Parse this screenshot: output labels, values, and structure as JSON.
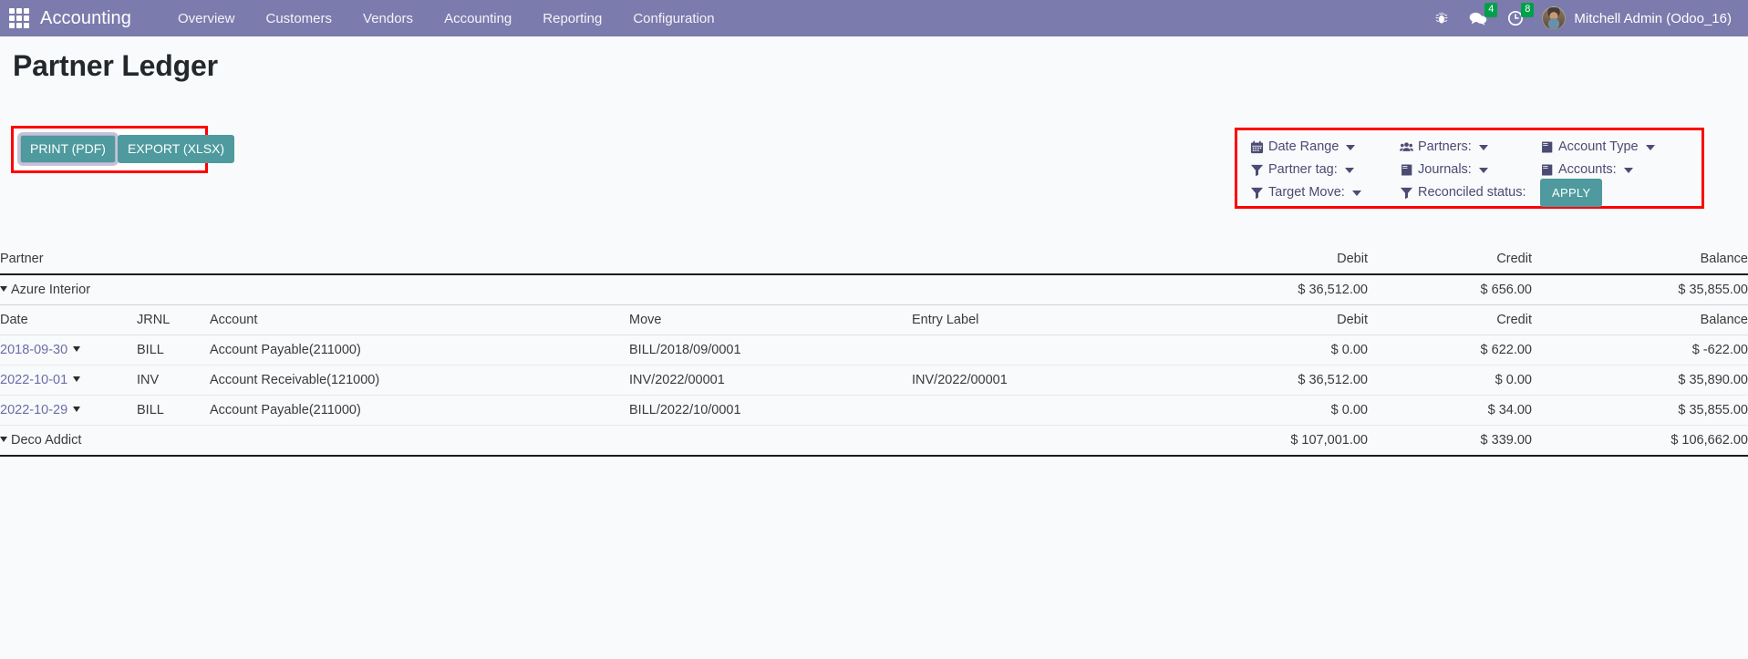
{
  "navbar": {
    "apps_icon": "apps-grid-icon",
    "brand": "Accounting",
    "menu": [
      {
        "label": "Overview"
      },
      {
        "label": "Customers"
      },
      {
        "label": "Vendors"
      },
      {
        "label": "Accounting"
      },
      {
        "label": "Reporting"
      },
      {
        "label": "Configuration"
      }
    ],
    "bug_icon": "bug-icon",
    "messages": {
      "icon": "chat-bubbles-icon",
      "count": "4"
    },
    "activities": {
      "icon": "clock-icon",
      "count": "8"
    },
    "user": {
      "avatar": "user-avatar",
      "name": "Mitchell Admin (Odoo_16)"
    },
    "brand_color": "#7c7bad",
    "badge_color": "#00a04a"
  },
  "page": {
    "title": "Partner Ledger"
  },
  "actions": {
    "print_pdf": "PRINT (PDF)",
    "export_xlsx": "EXPORT (XLSX)",
    "button_color": "#4e9a9e",
    "annotation_color": "#ff0000"
  },
  "filters": {
    "annotation_color": "#ff0000",
    "items": [
      {
        "label": "Date Range",
        "icon": "calendar-icon",
        "caret": true
      },
      {
        "label": "Partners:",
        "icon": "people-icon",
        "caret": true
      },
      {
        "label": "Account Type",
        "icon": "book-icon",
        "caret": true
      },
      {
        "label": "Partner tag:",
        "icon": "funnel-icon",
        "caret": true
      },
      {
        "label": "Journals:",
        "icon": "book-icon",
        "caret": true
      },
      {
        "label": "Accounts:",
        "icon": "book-icon",
        "caret": true
      },
      {
        "label": "Target Move:",
        "icon": "funnel-icon",
        "caret": true
      },
      {
        "label": "Reconciled status:",
        "icon": "funnel-icon",
        "caret": false
      }
    ],
    "apply_label": "APPLY"
  },
  "report": {
    "main_headers": [
      "Partner",
      "Debit",
      "Credit",
      "Balance"
    ],
    "sub_headers": [
      "Date",
      "JRNL",
      "Account",
      "Move",
      "Entry Label",
      "Debit",
      "Credit",
      "Balance"
    ],
    "partners": [
      {
        "name": "Azure Interior",
        "debit": "$ 36,512.00",
        "credit": "$ 656.00",
        "balance": "$ 35,855.00",
        "expanded": true,
        "lines": [
          {
            "date": "2018-09-30",
            "jrnl": "BILL",
            "account": "Account Payable(211000)",
            "move": "BILL/2018/09/0001",
            "entry_label": "",
            "debit": "$ 0.00",
            "credit": "$ 622.00",
            "balance": "$ -622.00"
          },
          {
            "date": "2022-10-01",
            "jrnl": "INV",
            "account": "Account Receivable(121000)",
            "move": "INV/2022/00001",
            "entry_label": "INV/2022/00001",
            "debit": "$ 36,512.00",
            "credit": "$ 0.00",
            "balance": "$ 35,890.00"
          },
          {
            "date": "2022-10-29",
            "jrnl": "BILL",
            "account": "Account Payable(211000)",
            "move": "BILL/2022/10/0001",
            "entry_label": "",
            "debit": "$ 0.00",
            "credit": "$ 34.00",
            "balance": "$ 35,855.00"
          }
        ]
      },
      {
        "name": "Deco Addict",
        "debit": "$ 107,001.00",
        "credit": "$ 339.00",
        "balance": "$ 106,662.00",
        "expanded": true,
        "lines": []
      }
    ]
  }
}
